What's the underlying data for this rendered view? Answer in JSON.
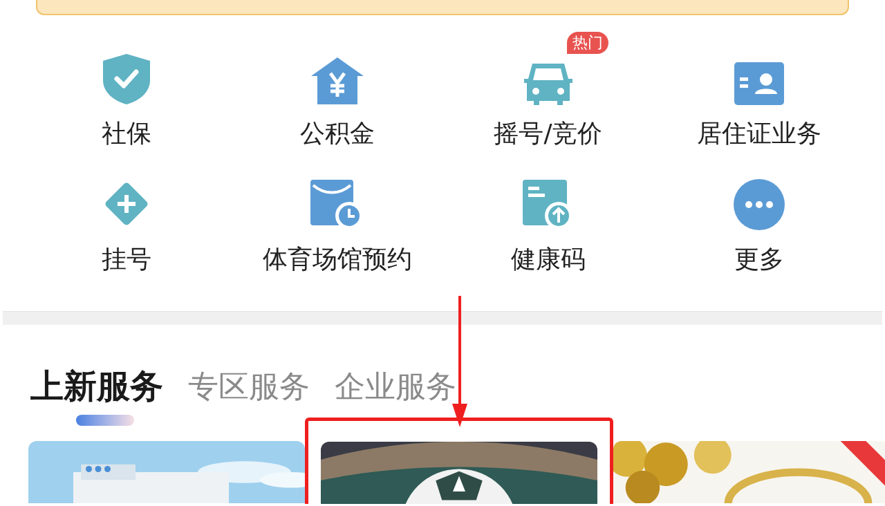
{
  "services": [
    {
      "kind": "shield",
      "label": "社保"
    },
    {
      "kind": "house",
      "label": "公积金"
    },
    {
      "kind": "car",
      "label": "摇号/竞价",
      "badge": "热门"
    },
    {
      "kind": "idcard",
      "label": "居住证业务"
    },
    {
      "kind": "diamond",
      "label": "挂号"
    },
    {
      "kind": "calendar",
      "label": "体育场馆预约"
    },
    {
      "kind": "upload",
      "label": "健康码"
    },
    {
      "kind": "more",
      "label": "更多"
    }
  ],
  "tabs": [
    {
      "label": "上新服务",
      "selected": true
    },
    {
      "label": "专区服务",
      "selected": false
    },
    {
      "label": "企业服务",
      "selected": false
    }
  ],
  "cards": [
    {
      "kind": "picture",
      "highlighted": false
    },
    {
      "kind": "picture",
      "highlighted": true
    },
    {
      "kind": "picture",
      "highlighted": false,
      "ribbon": true
    }
  ]
}
